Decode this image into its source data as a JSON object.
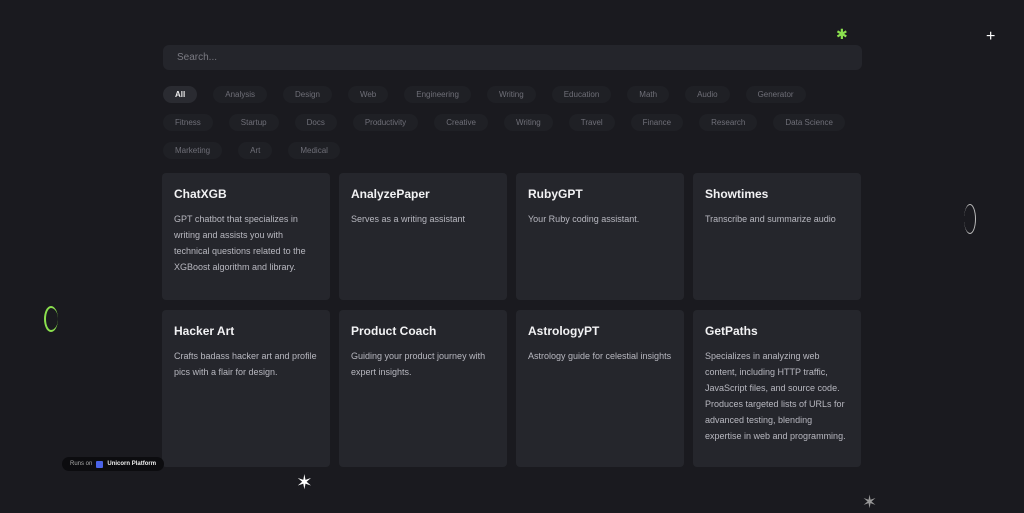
{
  "search": {
    "placeholder": "Search..."
  },
  "filters": [
    [
      "All",
      "Analysis",
      "Design",
      "Web",
      "Engineering",
      "Writing",
      "Education",
      "Math",
      "Audio",
      "Generator"
    ],
    [
      "Fitness",
      "Startup",
      "Docs",
      "Productivity",
      "Creative",
      "Writing",
      "Travel",
      "Finance",
      "Research",
      "Data Science"
    ],
    [
      "Marketing",
      "Art",
      "Medical"
    ]
  ],
  "cards": [
    {
      "title": "ChatXGB",
      "desc": "GPT chatbot that specializes in writing and assists you with technical questions related to the XGBoost algorithm and library."
    },
    {
      "title": "AnalyzePaper",
      "desc": "Serves as a writing assistant"
    },
    {
      "title": "RubyGPT",
      "desc": "Your Ruby coding assistant."
    },
    {
      "title": "Showtimes",
      "desc": "Transcribe and summarize audio"
    },
    {
      "title": "Hacker Art",
      "desc": "Crafts badass hacker art and profile pics with a flair for design."
    },
    {
      "title": "Product Coach",
      "desc": "Guiding your product journey with expert insights."
    },
    {
      "title": "AstrologyPT",
      "desc": "Astrology guide for celestial insights"
    },
    {
      "title": "GetPaths",
      "desc": "Specializes in analyzing web content, including HTTP traffic, JavaScript files, and source code. Produces targeted lists of URLs for advanced testing, blending expertise in web and programming."
    }
  ],
  "badge": {
    "prefix": "Runs on",
    "platform": "Unicorn Platform"
  },
  "colors": {
    "background": "#1a1a1f",
    "card": "#25262c",
    "accent": "#8be04e"
  }
}
